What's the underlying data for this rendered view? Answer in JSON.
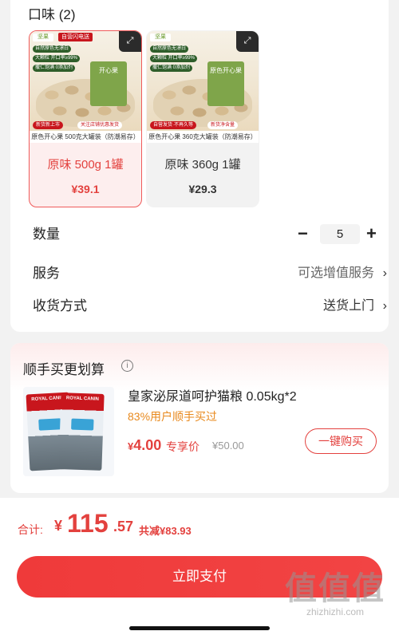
{
  "sku": {
    "section_title": "口味 (2)",
    "options": [
      {
        "name": "原味 500g 1罐",
        "price": "¥39.1",
        "selected": true,
        "image": {
          "logo": "坚果",
          "badge": "自营闪电送",
          "features": [
            "自然原色无漂白",
            "大颗粒 开口率≥99%",
            "撒仁饱满 0添加剂"
          ],
          "jar_label": "开心果",
          "promo": "新货新上市",
          "promo2": "关注店铺优惠发货",
          "caption": "原色开心果 500克大罐装（防潮易存）"
        }
      },
      {
        "name": "原味 360g 1罐",
        "price": "¥29.3",
        "selected": false,
        "image": {
          "logo": "坚果",
          "badge": "",
          "features": [
            "自然原色无漂白",
            "大颗粒 开口率≥99%",
            "撒仁饱满 0添加剂"
          ],
          "jar_label": "原色开心果",
          "promo": "自营发货·不再久等",
          "promo2": "新货净含量",
          "caption": "原色开心果 360克大罐装（防潮易存）"
        }
      }
    ]
  },
  "quantity": {
    "label": "数量",
    "value": "5",
    "minus": "−",
    "plus": "+"
  },
  "service": {
    "label": "服务",
    "value": "可选增值服务"
  },
  "delivery": {
    "label": "收货方式",
    "value": "送货上门"
  },
  "chevron": "›",
  "addon": {
    "title": "顺手买更划算",
    "info_glyph": "i",
    "product": {
      "title": "皇家泌尿道呵护猫粮 0.05kg*2",
      "subtitle": "83%用户顺手买过",
      "price_currency": "¥",
      "price": "4.00",
      "price_tag": "专享价",
      "original_price": "¥50.00",
      "buy_label": "一键购买",
      "brand_on_pack": "ROYAL CANIN"
    }
  },
  "footer": {
    "total_label": "合计:",
    "currency": "¥",
    "total_int": "115",
    "total_dec": ".57",
    "saved": "共减¥83.93",
    "pay_label": "立即支付"
  },
  "watermark": {
    "glyph": "值值值",
    "url": "zhizhizhi.com"
  },
  "colors": {
    "accent": "#e3413e",
    "selected_bg": "#fdeeee",
    "subtitle_orange": "#e8891d"
  }
}
